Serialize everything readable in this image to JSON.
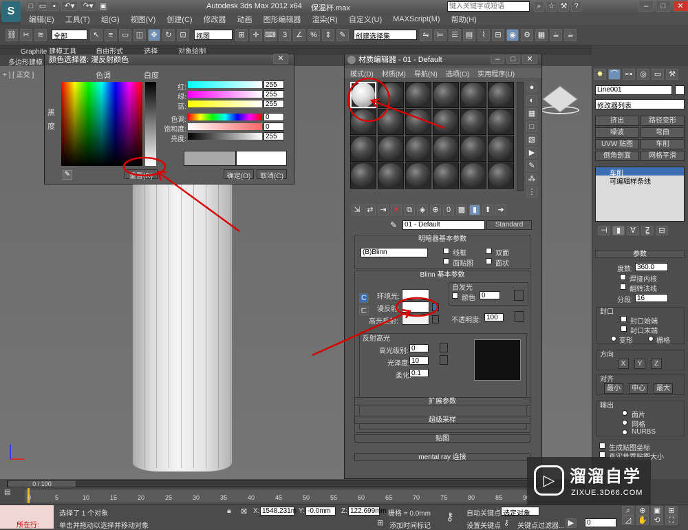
{
  "title": {
    "app": "Autodesk 3ds Max  2012 x64",
    "file": "保温杯.max",
    "search_placeholder": "键入关键字或短语"
  },
  "menu": [
    "编辑(E)",
    "工具(T)",
    "组(G)",
    "视图(V)",
    "创建(C)",
    "修改器",
    "动画",
    "图形编辑器",
    "渲染(R)",
    "自定义(U)",
    "MAXScript(M)",
    "帮助(H)"
  ],
  "toolbar": {
    "selection_filter": "全部",
    "ref_coord": "视图",
    "named_sel": "创建选择集"
  },
  "ribbon": {
    "tabs": [
      "Graphite 建模工具",
      "自由形式",
      "选择",
      "对象绘制"
    ],
    "subtab": "多边形建模"
  },
  "viewport": {
    "label": "+ ] [ 正交 ]"
  },
  "color_selector": {
    "title": "颜色选择器: 漫反射颜色",
    "hue_label": "色调",
    "white_label": "白度",
    "black_label": "黑",
    "degree_label": "度",
    "r": {
      "label": "红:",
      "value": "255"
    },
    "g": {
      "label": "绿:",
      "value": "255"
    },
    "b": {
      "label": "蓝:",
      "value": "255"
    },
    "hue": {
      "label": "色调:",
      "value": "0"
    },
    "sat": {
      "label": "饱和度:",
      "value": "0"
    },
    "val": {
      "label": "亮度:",
      "value": "255"
    },
    "reset": "重置(R)",
    "ok": "确定(O)",
    "cancel": "取消(C)"
  },
  "mat_editor": {
    "title": "材质编辑器 - 01 - Default",
    "menu": [
      "模式(D)",
      "材质(M)",
      "导航(N)",
      "选项(O)",
      "实用程序(U)"
    ],
    "material_name": "01 - Default",
    "material_type": "Standard",
    "shader_rollout": "明暗器基本参数",
    "shader": "(B)Blinn",
    "wire": "线框",
    "two_sided": "双面",
    "face_map": "面贴图",
    "faceted": "面状",
    "blinn_rollout": "Blinn 基本参数",
    "self_illum": "自发光",
    "self_color": "颜色",
    "self_value": "0",
    "ambient": "环境光:",
    "diffuse": "漫反射:",
    "specular": "高光反射:",
    "opacity": "不透明度:",
    "opacity_value": "100",
    "spec_highlights": "反射高光",
    "spec_level": "高光级别:",
    "spec_level_value": "0",
    "gloss": "光泽度:",
    "gloss_value": "10",
    "soften": "柔化:",
    "soften_value": "0.1",
    "rollouts": [
      "扩展参数",
      "超级采样",
      "贴图",
      "mental ray 连接"
    ]
  },
  "cmd": {
    "object_name": "Line001",
    "modifier_list": "修改器列表",
    "buttons": [
      "挤出",
      "路径变形",
      "噪波",
      "弯曲",
      "UVW 贴图",
      "车削",
      "倒角剖面",
      "网格平滑"
    ],
    "stack": [
      "车削",
      "可编辑样条线"
    ],
    "params_title": "参数",
    "degrees_label": "度数:",
    "degrees_value": "360.0",
    "weld_core": "焊接内核",
    "flip_normals": "翻转法线",
    "segments_label": "分段:",
    "segments_value": "16",
    "capping": "封口",
    "cap_start": "封口始端",
    "cap_end": "封口末端",
    "morph": "变形",
    "grid": "栅格",
    "direction": "方向",
    "x": "X",
    "y": "Y",
    "z": "Z",
    "align": "对齐",
    "min": "最小",
    "center": "中心",
    "max": "最大",
    "output": "输出",
    "patch": "面片",
    "mesh": "网格",
    "nurbs": "NURBS",
    "gen_map": "生成贴图坐标",
    "real_world": "真实世界贴图大小"
  },
  "timeline": {
    "frame": "0 / 100",
    "ticks": [
      "0",
      "5",
      "10",
      "15",
      "20",
      "25",
      "30",
      "35",
      "40",
      "45",
      "50",
      "55",
      "60",
      "65",
      "70",
      "75",
      "80",
      "85",
      "90"
    ]
  },
  "status": {
    "script": "所在行:",
    "selected": "选择了 1 个对象",
    "hint": "单击并拖动以选择并移动对象",
    "x_label": "X:",
    "x_value": "1548.231m",
    "y_label": "Y:",
    "y_value": "-0.0mm",
    "z_label": "Z:",
    "z_value": "122.699mm",
    "grid": "栅格 = 0.0mm",
    "add_time_tag": "添加时间标记",
    "auto_key": "自动关键点",
    "auto_key_sel": "选定对象",
    "set_key": "设置关键点",
    "key_filters": "关键点过滤器...",
    "frame_value": "0"
  },
  "watermark": {
    "name": "溜溜自学",
    "url": "ZIXUE.3D66.COM"
  }
}
